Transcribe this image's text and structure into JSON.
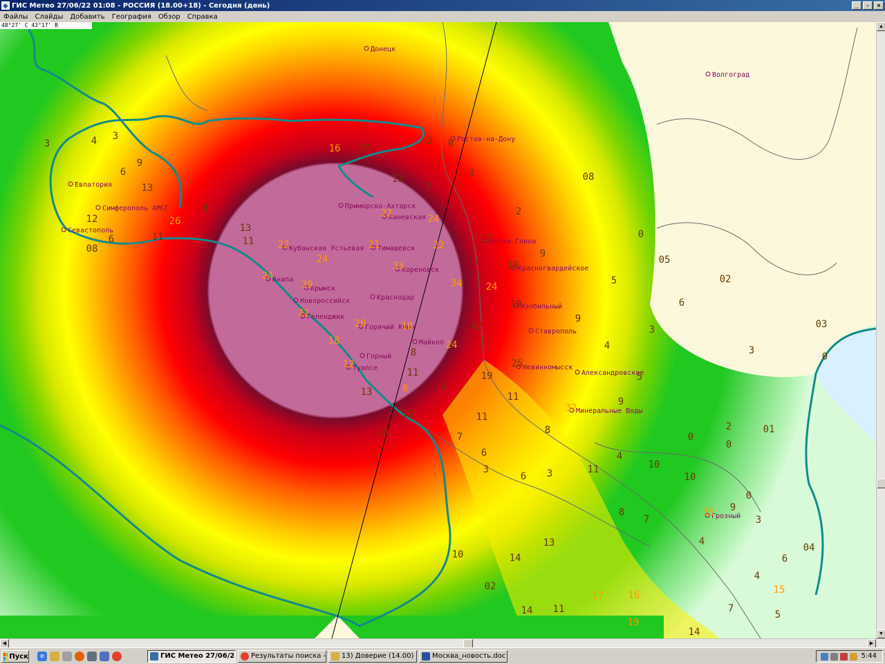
{
  "window": {
    "title": "ГИС Метео 27/06/22 01:08 - РОССИЯ (18.00+18) - Сегодня (день)",
    "buttons": [
      "_",
      "▫",
      "×"
    ]
  },
  "menu": [
    "Файлы",
    "Слайды",
    "Добавить",
    "География",
    "Обзор",
    "Справка"
  ],
  "coord_readout": "48°27' С 43°17' В",
  "colors": {
    "center_pink": "#c26a9a",
    "maroon": "#7a0a2a",
    "red": "#ff0000",
    "orange": "#ff9000",
    "yellow": "#ffff00",
    "green": "#20c820",
    "light_green": "#a8f0a8",
    "land_beige": "#fdf8dc",
    "water": "#d8f0ff",
    "coastline": "#138a8a",
    "city_text": "#8a0a5a",
    "value_orange": "#ff9900",
    "value_brown": "#6a3a00"
  },
  "cities": [
    {
      "name": "Донецк"
    },
    {
      "name": "Волгоград"
    },
    {
      "name": "Ростов-на-Дону"
    },
    {
      "name": "Евпатория"
    },
    {
      "name": "Симферополь АМСГ"
    },
    {
      "name": "Севастополь"
    },
    {
      "name": "Приморско-Ахтарск"
    },
    {
      "name": "Каневская"
    },
    {
      "name": "Кубанская Устьевая"
    },
    {
      "name": "Тимашевск"
    },
    {
      "name": "Кореновск"
    },
    {
      "name": "Анапа"
    },
    {
      "name": "Крымск"
    },
    {
      "name": "Новороссийск"
    },
    {
      "name": "Краснодар"
    },
    {
      "name": "Геленджик"
    },
    {
      "name": "Горячий Ключ"
    },
    {
      "name": "Майкоп"
    },
    {
      "name": "Горный"
    },
    {
      "name": "Туапсе"
    },
    {
      "name": "Белая Глина"
    },
    {
      "name": "Красногвардейское"
    },
    {
      "name": "Изобильный"
    },
    {
      "name": "Ставрополь"
    },
    {
      "name": "Невинномысск"
    },
    {
      "name": "Александровское"
    },
    {
      "name": "Минеральные Воды"
    },
    {
      "name": "Грозный"
    }
  ],
  "values": [
    {
      "v": "3"
    },
    {
      "v": "4"
    },
    {
      "v": "3"
    },
    {
      "v": "9"
    },
    {
      "v": "6"
    },
    {
      "v": "13"
    },
    {
      "v": "12"
    },
    {
      "v": "6"
    },
    {
      "v": "08"
    },
    {
      "v": "8"
    },
    {
      "v": "26"
    },
    {
      "v": "13"
    },
    {
      "v": "11"
    },
    {
      "v": "16"
    },
    {
      "v": "10"
    },
    {
      "v": "2"
    },
    {
      "v": "0"
    },
    {
      "v": "13"
    },
    {
      "v": "7"
    },
    {
      "v": "3"
    },
    {
      "v": "08"
    },
    {
      "v": "2"
    },
    {
      "v": "17"
    },
    {
      "v": "9"
    },
    {
      "v": "0"
    },
    {
      "v": "05"
    },
    {
      "v": "18"
    },
    {
      "v": "24"
    },
    {
      "v": "5"
    },
    {
      "v": "02"
    },
    {
      "v": "24"
    },
    {
      "v": "19"
    },
    {
      "v": "6"
    },
    {
      "v": "9"
    },
    {
      "v": "3"
    },
    {
      "v": "42"
    },
    {
      "v": "4"
    },
    {
      "v": "03"
    },
    {
      "v": "3"
    },
    {
      "v": "0"
    },
    {
      "v": "18"
    },
    {
      "v": "8"
    },
    {
      "v": "24"
    },
    {
      "v": "11"
    },
    {
      "v": "19"
    },
    {
      "v": "25"
    },
    {
      "v": "5"
    },
    {
      "v": "13"
    },
    {
      "v": "9"
    },
    {
      "v": "11"
    },
    {
      "v": "9"
    },
    {
      "v": "12"
    },
    {
      "v": "10"
    },
    {
      "v": "11"
    },
    {
      "v": "7"
    },
    {
      "v": "8"
    },
    {
      "v": "2"
    },
    {
      "v": "01"
    },
    {
      "v": "0"
    },
    {
      "v": "0"
    },
    {
      "v": "6"
    },
    {
      "v": "4"
    },
    {
      "v": "10"
    },
    {
      "v": "3"
    },
    {
      "v": "6"
    },
    {
      "v": "3"
    },
    {
      "v": "11"
    },
    {
      "v": "10"
    },
    {
      "v": "0"
    },
    {
      "v": "8"
    },
    {
      "v": "7"
    },
    {
      "v": "9"
    },
    {
      "v": "3"
    },
    {
      "v": "13"
    },
    {
      "v": "4"
    },
    {
      "v": "04"
    },
    {
      "v": "10"
    },
    {
      "v": "14"
    },
    {
      "v": "6"
    },
    {
      "v": "02"
    },
    {
      "v": "4"
    },
    {
      "v": "15"
    },
    {
      "v": "17"
    },
    {
      "v": "16"
    },
    {
      "v": "7"
    },
    {
      "v": "14"
    },
    {
      "v": "11"
    },
    {
      "v": "5"
    },
    {
      "v": "19"
    },
    {
      "v": "14"
    },
    {
      "v": "22"
    },
    {
      "v": "21"
    },
    {
      "v": "24"
    },
    {
      "v": "33"
    },
    {
      "v": "24"
    },
    {
      "v": "39"
    },
    {
      "v": "34"
    },
    {
      "v": "21"
    },
    {
      "v": "20"
    },
    {
      "v": "18"
    },
    {
      "v": "22"
    },
    {
      "v": "22"
    },
    {
      "v": "12"
    },
    {
      "v": "8"
    },
    {
      "v": "32"
    },
    {
      "v": "35"
    },
    {
      "v": "11"
    }
  ],
  "taskbar": {
    "start": "Пуск",
    "tasks": [
      "ГИС Метео 27/06/22 ...",
      "Результаты поиска - е...",
      "13) Доверие (14.00)",
      "Москва_новость.doc - ..."
    ],
    "clock": "5:44"
  }
}
